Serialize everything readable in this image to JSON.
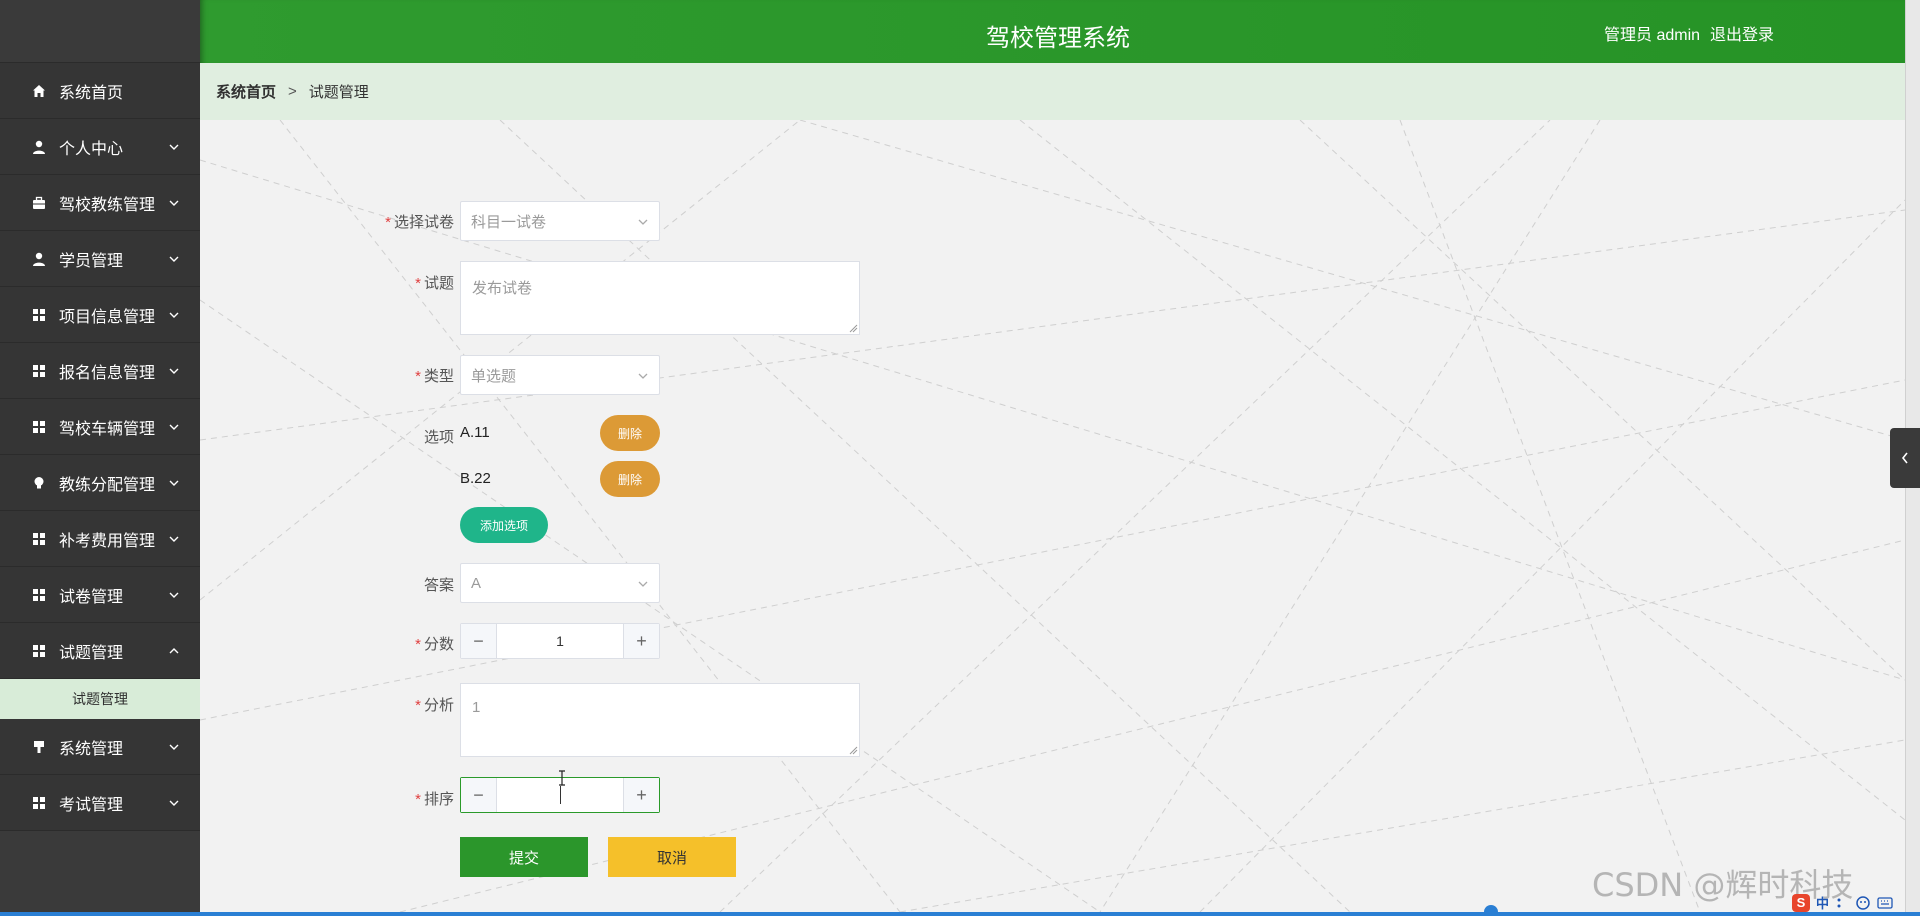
{
  "header": {
    "title": "驾校管理系统",
    "user_label": "管理员 admin",
    "logout_label": "退出登录"
  },
  "sidebar": {
    "items": [
      {
        "label": "系统首页",
        "icon": "home-icon",
        "has_arrow": false
      },
      {
        "label": "个人中心",
        "icon": "user-icon",
        "has_arrow": true
      },
      {
        "label": "驾校教练管理",
        "icon": "briefcase-icon",
        "has_arrow": true
      },
      {
        "label": "学员管理",
        "icon": "user-icon",
        "has_arrow": true
      },
      {
        "label": "项目信息管理",
        "icon": "grid-icon",
        "has_arrow": true
      },
      {
        "label": "报名信息管理",
        "icon": "grid-icon",
        "has_arrow": true
      },
      {
        "label": "驾校车辆管理",
        "icon": "grid-icon",
        "has_arrow": true
      },
      {
        "label": "教练分配管理",
        "icon": "bulb-icon",
        "has_arrow": true
      },
      {
        "label": "补考费用管理",
        "icon": "grid-icon",
        "has_arrow": true
      },
      {
        "label": "试卷管理",
        "icon": "grid-icon",
        "has_arrow": true
      },
      {
        "label": "试题管理",
        "icon": "grid-icon",
        "has_arrow": true,
        "expanded": true
      },
      {
        "label": "系统管理",
        "icon": "pin-icon",
        "has_arrow": true
      },
      {
        "label": "考试管理",
        "icon": "grid-icon",
        "has_arrow": true
      }
    ],
    "submenu": {
      "label": "试题管理"
    }
  },
  "breadcrumb": {
    "home": "系统首页",
    "separator": ">",
    "current": "试题管理"
  },
  "form": {
    "paper": {
      "label": "选择试卷",
      "value": "科目一试卷"
    },
    "question": {
      "label": "试题",
      "value": "发布试卷"
    },
    "type": {
      "label": "类型",
      "value": "单选题"
    },
    "options": {
      "label": "选项",
      "items": [
        {
          "text": "A.11",
          "delete_label": "删除"
        },
        {
          "text": "B.22",
          "delete_label": "删除"
        }
      ],
      "add_label": "添加选项"
    },
    "answer": {
      "label": "答案",
      "value": "A"
    },
    "score": {
      "label": "分数",
      "value": "1",
      "minus": "−",
      "plus": "+"
    },
    "analysis": {
      "label": "分析",
      "value": "1"
    },
    "order": {
      "label": "排序",
      "value": "",
      "minus": "−",
      "plus": "+"
    },
    "submit_label": "提交",
    "cancel_label": "取消"
  },
  "watermark": "CSDN @辉时科技",
  "ime": {
    "logo": "S",
    "lang": "中"
  },
  "colors": {
    "header_green": "#2a9a2a",
    "sidebar_dark": "#3a3a3a",
    "delete_orange": "#dc9a36",
    "add_teal": "#1fb58a",
    "cancel_yellow": "#f5c02a"
  }
}
